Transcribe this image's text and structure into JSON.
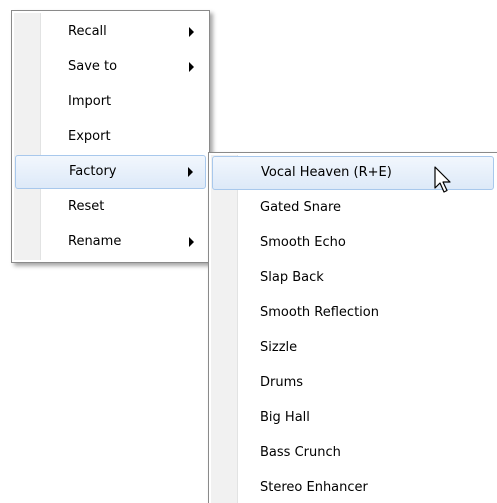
{
  "context_menu": {
    "items": [
      {
        "label": "Recall",
        "has_submenu": true
      },
      {
        "label": "Save to",
        "has_submenu": true
      },
      {
        "label": "Import",
        "has_submenu": false
      },
      {
        "label": "Export",
        "has_submenu": false
      },
      {
        "label": "Factory",
        "has_submenu": true,
        "highlighted": true
      },
      {
        "label": "Reset",
        "has_submenu": false
      },
      {
        "label": "Rename",
        "has_submenu": true
      }
    ]
  },
  "factory_submenu": {
    "items": [
      {
        "label": "Vocal Heaven (R+E)",
        "highlighted": true
      },
      {
        "label": "Gated Snare"
      },
      {
        "label": "Smooth Echo"
      },
      {
        "label": "Slap Back"
      },
      {
        "label": "Smooth Reflection"
      },
      {
        "label": "Sizzle"
      },
      {
        "label": "Drums"
      },
      {
        "label": "Big Hall"
      },
      {
        "label": "Bass Crunch"
      },
      {
        "label": "Stereo Enhancer"
      }
    ]
  },
  "colors": {
    "highlight_border": "#a8c8ec",
    "highlight_fill": "#dde9f8",
    "menu_border": "#8a8a8a"
  },
  "icons": {
    "cursor": "mouse-pointer-icon",
    "submenu_arrow": "triangle-right-icon"
  }
}
